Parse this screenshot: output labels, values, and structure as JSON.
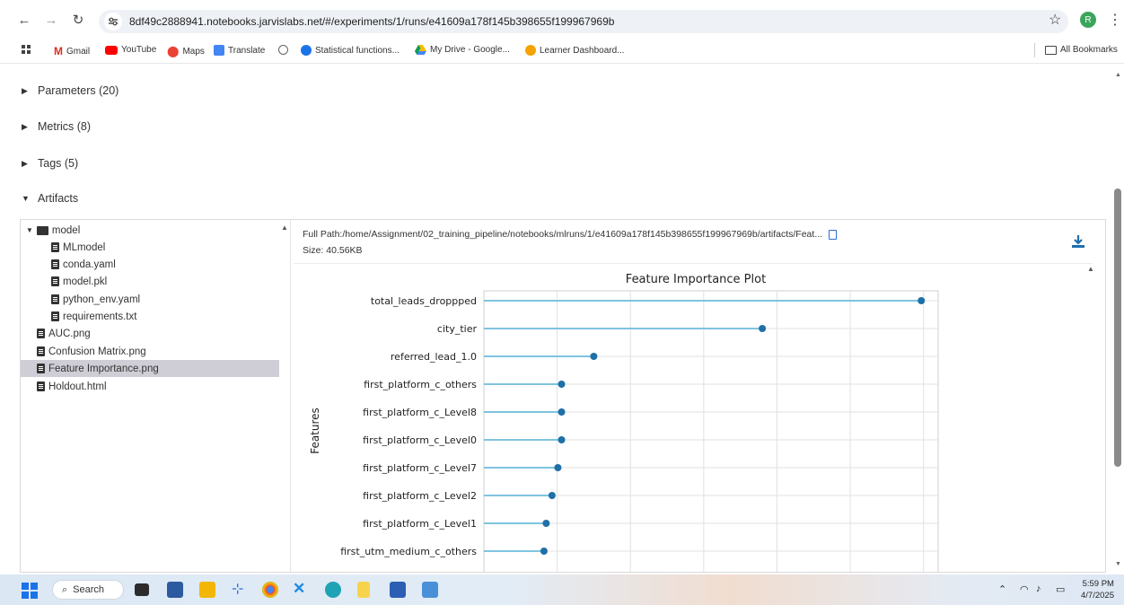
{
  "browser": {
    "url": "8df49c2888941.notebooks.jarvislabs.net/#/experiments/1/runs/e41609a178f145b398655f199967969b",
    "profile_initial": "R"
  },
  "bookmarks": [
    {
      "label": "Gmail",
      "color": "#d93025"
    },
    {
      "label": "YouTube",
      "color": "#ff0000"
    },
    {
      "label": "Maps",
      "color": "#34a853"
    },
    {
      "label": "Translate",
      "color": "#4285f4"
    },
    {
      "label": "",
      "color": "#5f6368"
    },
    {
      "label": "Statistical functions...",
      "color": "#1a73e8"
    },
    {
      "label": "My Drive - Google...",
      "color": "#fbbc04"
    },
    {
      "label": "Learner Dashboard...",
      "color": "#f4a300"
    }
  ],
  "all_bookmarks": "All Bookmarks",
  "sections": {
    "parameters": "Parameters (20)",
    "metrics": "Metrics (8)",
    "tags": "Tags (5)",
    "artifacts": "Artifacts"
  },
  "tree": {
    "model": "model",
    "children": [
      "MLmodel",
      "conda.yaml",
      "model.pkl",
      "python_env.yaml",
      "requirements.txt"
    ],
    "files": [
      "AUC.png",
      "Confusion Matrix.png",
      "Feature Importance.png",
      "Holdout.html"
    ],
    "selected": "Feature Importance.png"
  },
  "preview": {
    "full_path": "Full Path:/home/Assignment/02_training_pipeline/notebooks/mlruns/1/e41609a178f145b398655f199967969b/artifacts/Feat...",
    "size": "Size: 40.56KB"
  },
  "chart_data": {
    "type": "lollipop",
    "title": "Feature Importance Plot",
    "ylabel": "Features",
    "xlabel": "",
    "categories": [
      "total_leads_droppped",
      "city_tier",
      "referred_lead_1.0",
      "first_platform_c_others",
      "first_platform_c_Level8",
      "first_platform_c_Level0",
      "first_platform_c_Level7",
      "first_platform_c_Level2",
      "first_platform_c_Level1",
      "first_utm_medium_c_others"
    ],
    "values": [
      597,
      380,
      150,
      106,
      106,
      106,
      101,
      93,
      85,
      82
    ],
    "xlim": [
      0,
      620
    ],
    "grid": true,
    "color": "#1f6fa8",
    "stem_color": "#7ec4df"
  },
  "taskbar": {
    "search_label": "Search",
    "time": "5:59 PM",
    "date": "4/7/2025"
  }
}
